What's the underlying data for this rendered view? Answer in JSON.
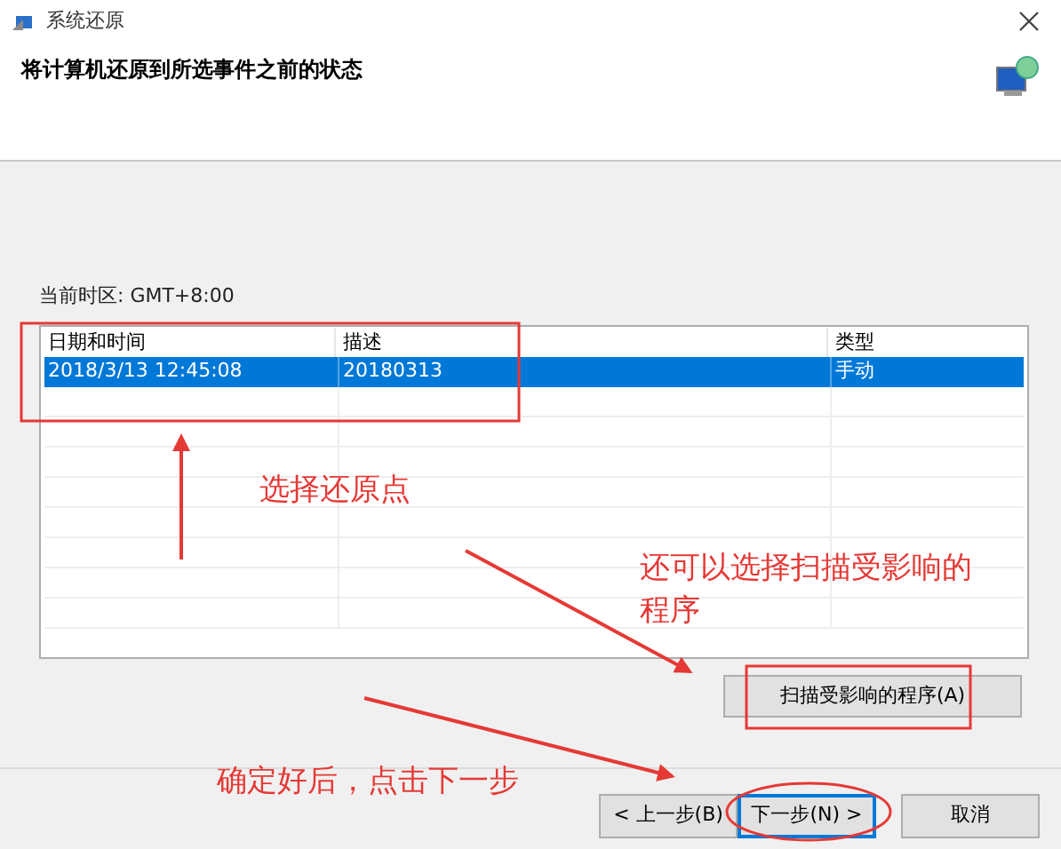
{
  "window": {
    "title": "系统还原"
  },
  "header": {
    "heading": "将计算机还原到所选事件之前的状态"
  },
  "timezone": "当前时区: GMT+8:00",
  "table": {
    "columns": [
      "日期和时间",
      "描述",
      "类型"
    ],
    "rows": [
      {
        "cells": [
          "2018/3/13 12:45:08",
          "20180313",
          "手动"
        ],
        "selected": true
      }
    ]
  },
  "scan_button": "扫描受影响的程序(A)",
  "buttons": [
    {
      "label": "< 上一步(B)",
      "selected": false
    },
    {
      "label": "下一步(N) >",
      "selected": true
    },
    {
      "label": "取消",
      "selected": false
    }
  ],
  "annotations": [
    "选择还原点",
    "还可以选择扫描受影响的程序",
    "确定好后，点击下一步"
  ]
}
